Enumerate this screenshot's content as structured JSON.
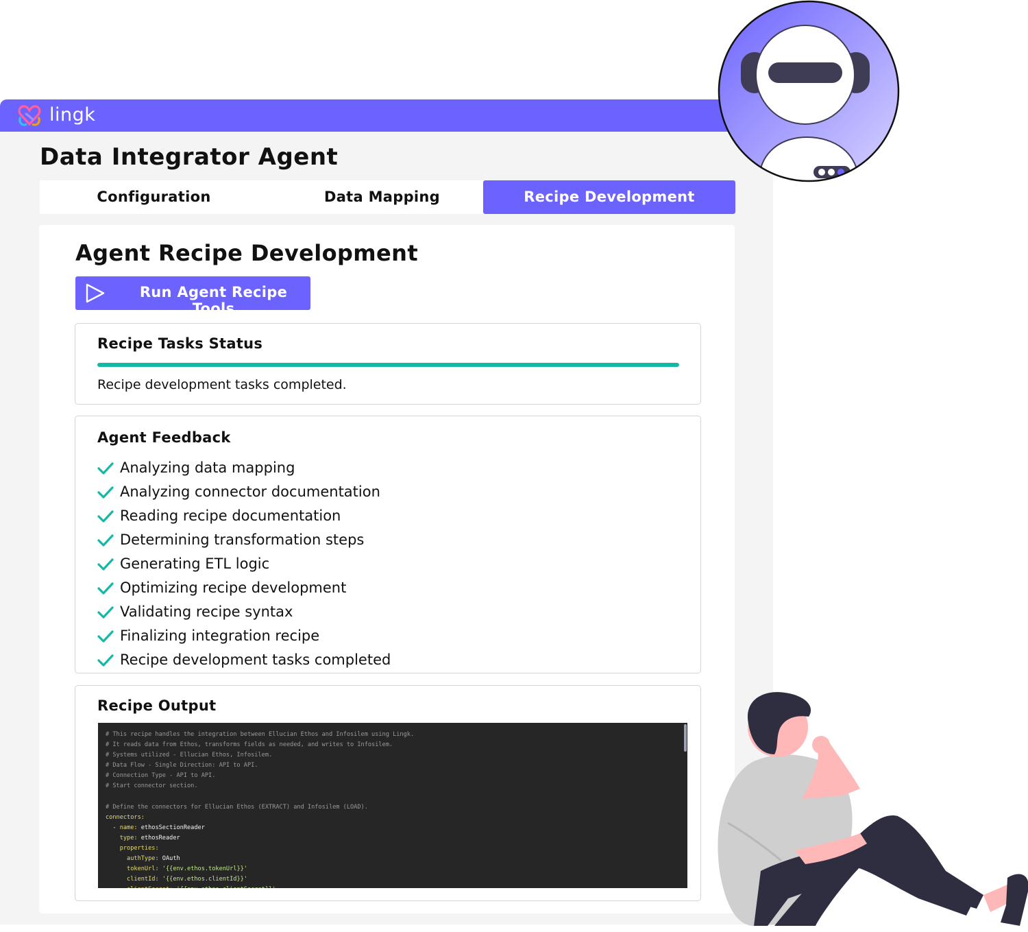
{
  "app": {
    "logo_text": "lingk",
    "title": "Data Integrator Agent",
    "brand_color": "#6c63ff"
  },
  "tabs": [
    {
      "label": "Configuration",
      "active": false
    },
    {
      "label": "Data Mapping",
      "active": false
    },
    {
      "label": "Recipe Development",
      "active": true
    }
  ],
  "main": {
    "title": "Agent Recipe Development",
    "run_button": {
      "label": "Run Agent Recipe Tools",
      "icon": "play-icon"
    }
  },
  "status_card": {
    "title": "Recipe Tasks Status",
    "progress_percent": 100,
    "progress_color": "#14b8a6",
    "status_text": "Recipe development tasks completed."
  },
  "feedback_card": {
    "title": "Agent Feedback",
    "icon": "check-icon",
    "items": [
      "Analyzing data mapping",
      "Analyzing connector documentation",
      "Reading recipe documentation",
      "Determining transformation steps",
      "Generating ETL logic",
      "Optimizing recipe development",
      "Validating recipe syntax",
      "Finalizing integration recipe",
      "Recipe development tasks completed"
    ]
  },
  "output_card": {
    "title": "Recipe Output",
    "code_lines": [
      {
        "type": "comment",
        "text": "# This recipe handles the integration between Ellucian Ethos and Infosilem using Lingk."
      },
      {
        "type": "comment",
        "text": "# It reads data from Ethos, transforms fields as needed, and writes to Infosilem."
      },
      {
        "type": "comment",
        "text": "# Systems utilized - Ellucian Ethos, Infosilem."
      },
      {
        "type": "comment",
        "text": "# Data Flow - Single Direction: API to API."
      },
      {
        "type": "comment",
        "text": "# Connection Type - API to API."
      },
      {
        "type": "comment",
        "text": "# Start connector section."
      },
      {
        "type": "blank",
        "text": ""
      },
      {
        "type": "comment",
        "text": "# Define the connectors for Ellucian Ethos (EXTRACT) and Infosilem (LOAD)."
      },
      {
        "type": "key",
        "indent": "",
        "key": "connectors:",
        "value": ""
      },
      {
        "type": "key",
        "indent": "  - ",
        "key": "name:",
        "value": " ethosSectionReader"
      },
      {
        "type": "key",
        "indent": "    ",
        "key": "type:",
        "value": " ethosReader"
      },
      {
        "type": "key",
        "indent": "    ",
        "key": "properties:",
        "value": ""
      },
      {
        "type": "key",
        "indent": "      ",
        "key": "authType:",
        "value": " OAuth"
      },
      {
        "type": "keystr",
        "indent": "      ",
        "key": "tokenUrl:",
        "value": " '{{env.ethos.tokenUrl}}'"
      },
      {
        "type": "keystr",
        "indent": "      ",
        "key": "clientId:",
        "value": " '{{env.ethos.clientId}}'"
      },
      {
        "type": "keystr",
        "indent": "      ",
        "key": "clientSecret:",
        "value": " '{{env.ethos.clientSecret}}'"
      }
    ]
  }
}
